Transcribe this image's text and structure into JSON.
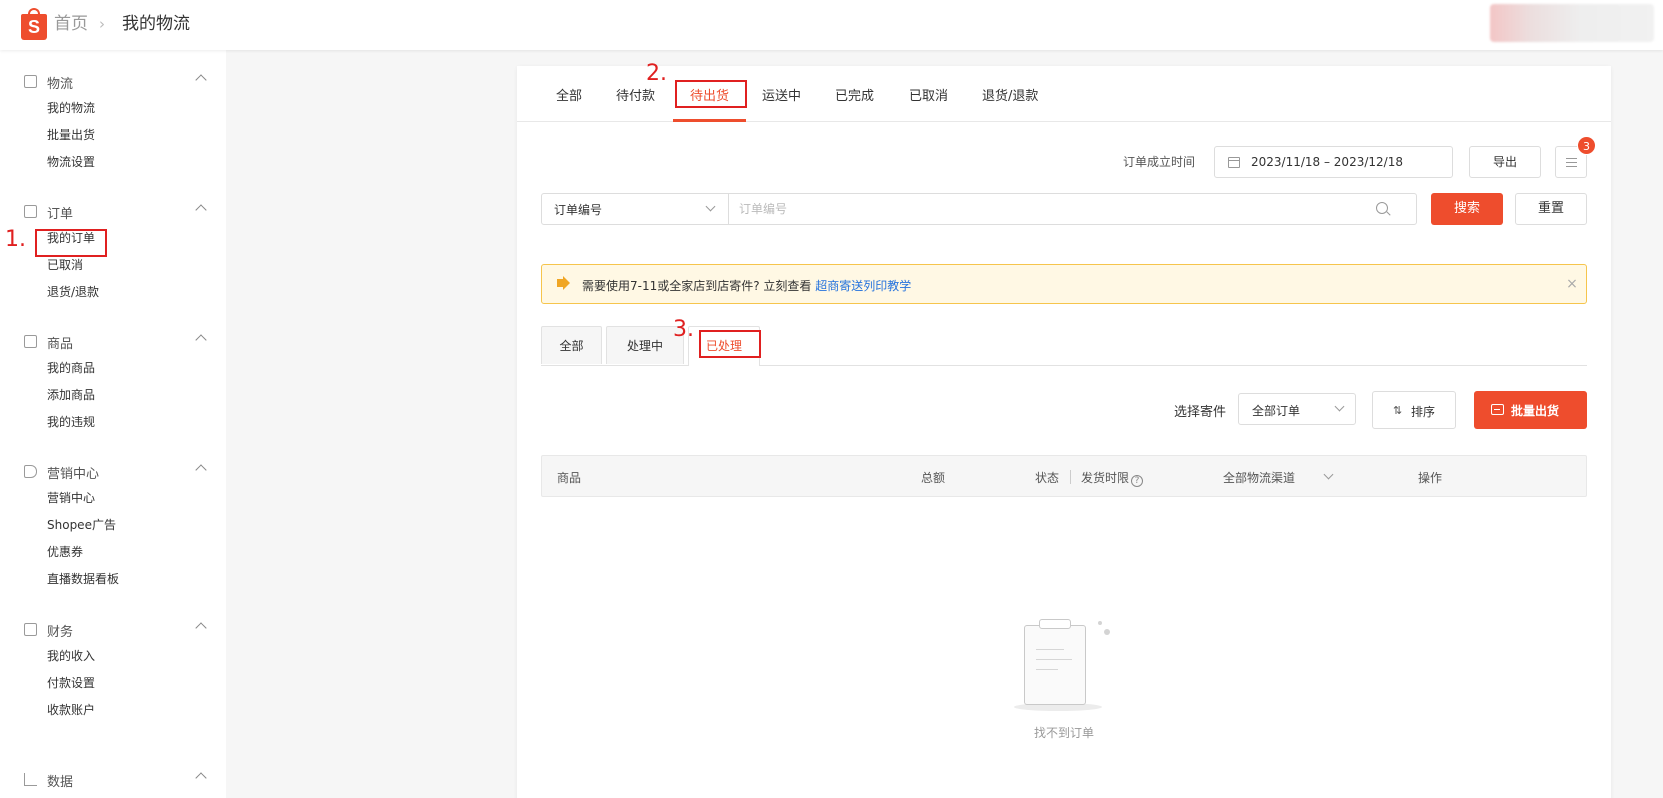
{
  "header": {
    "logo_letter": "S",
    "breadcrumb_home": "首页",
    "breadcrumb_sep": "›",
    "breadcrumb_current": "我的物流"
  },
  "sidebar": {
    "sections": [
      {
        "title": "物流",
        "icon": "package-icon",
        "items": [
          "我的物流",
          "批量出货",
          "物流设置"
        ]
      },
      {
        "title": "订单",
        "icon": "clipboard-icon",
        "items": [
          "我的订单",
          "已取消",
          "退货/退款"
        ]
      },
      {
        "title": "商品",
        "icon": "box-icon",
        "items": [
          "我的商品",
          "添加商品",
          "我的违规"
        ]
      },
      {
        "title": "营销中心",
        "icon": "tag-icon",
        "items": [
          "营销中心",
          "Shopee广告",
          "优惠券",
          "直播数据看板"
        ]
      },
      {
        "title": "财务",
        "icon": "wallet-icon",
        "items": [
          "我的收入",
          "付款设置",
          "收款账户"
        ]
      },
      {
        "title": "数据",
        "icon": "chart-icon",
        "items": []
      }
    ]
  },
  "annotations": [
    "1.",
    "2.",
    "3."
  ],
  "order_tabs": [
    "全部",
    "待付款",
    "待出货",
    "运送中",
    "已完成",
    "已取消",
    "退货/退款"
  ],
  "order_tabs_active": "待出货",
  "filter": {
    "time_label": "订单成立时间",
    "date_range": "2023/11/18 – 2023/12/18",
    "export_label": "导出",
    "badge_count": "3"
  },
  "search": {
    "type_value": "订单编号",
    "placeholder": "订单编号",
    "search_label": "搜索",
    "reset_label": "重置"
  },
  "notice": {
    "text": "需要使用7-11或全家店到店寄件? 立刻查看 ",
    "link": "超商寄送列印教学",
    "close": "×"
  },
  "sub_tabs": [
    "全部",
    "处理中",
    "已处理"
  ],
  "sub_tabs_active": "已处理",
  "actions": {
    "select_label": "选择寄件",
    "select_value": "全部订单",
    "sort_label": "排序",
    "batch_label": "批量出货"
  },
  "table": {
    "columns": [
      "商品",
      "总额",
      "状态",
      "发货时限",
      "全部物流渠道",
      "操作"
    ]
  },
  "empty": {
    "text": "找不到订单"
  },
  "colors": {
    "brand": "#ee4d2d",
    "annotation": "#e02020",
    "link": "#2673dd",
    "notice_bg": "#fff8e4"
  }
}
